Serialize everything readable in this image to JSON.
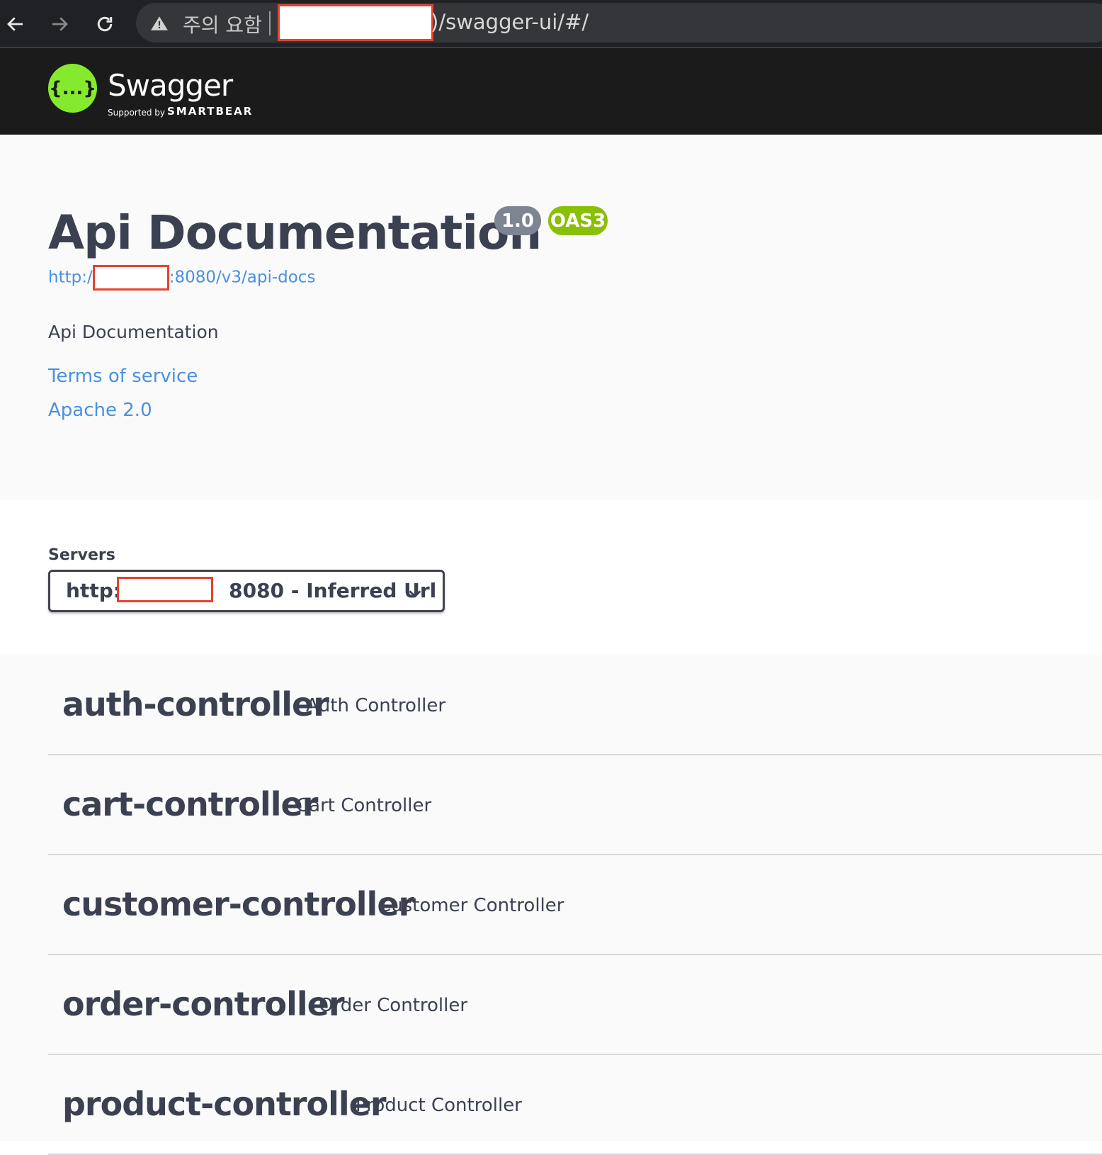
{
  "browser": {
    "warning_text": "주의 요함",
    "url_path": ")/swagger-ui/#/"
  },
  "topbar": {
    "logo_glyph": "{...}",
    "brand_name": "Swagger",
    "supported_by": "Supported by",
    "company": "SMARTBEAR"
  },
  "info": {
    "title": "Api Documentation",
    "version": "1.0",
    "oas_badge": "OAS3",
    "docs_url_prefix": "http:/",
    "docs_url_suffix": ":8080/v3/api-docs",
    "description": "Api Documentation",
    "terms_link": "Terms of service",
    "license_link": "Apache 2.0"
  },
  "servers": {
    "label": "Servers",
    "selected_prefix": "http:/",
    "selected_suffix": "8080 - Inferred Url"
  },
  "tags": [
    {
      "name": "auth-controller",
      "description": "Auth Controller"
    },
    {
      "name": "cart-controller",
      "description": "Cart Controller"
    },
    {
      "name": "customer-controller",
      "description": "Customer Controller"
    },
    {
      "name": "order-controller",
      "description": "Order Controller"
    },
    {
      "name": "product-controller",
      "description": "Product Controller"
    }
  ],
  "colors": {
    "brand_green": "#85ea2d",
    "link_blue": "#4990e2",
    "text_dark": "#3b4151",
    "version_badge": "#7d8492",
    "oas_badge": "#89bf04",
    "redaction_border": "#e5432f"
  }
}
